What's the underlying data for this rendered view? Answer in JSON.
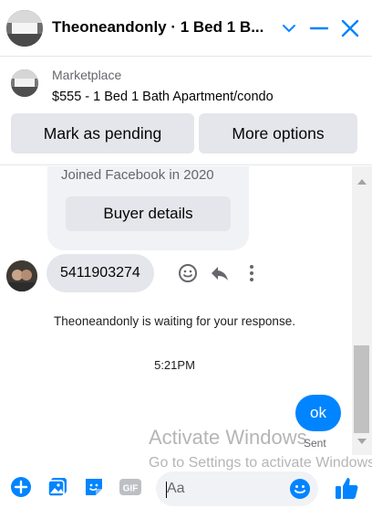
{
  "header": {
    "title": "Theoneandonly · 1 Bed 1 B...",
    "avatar_icon": "profile-photo",
    "icons": [
      "chevron-down-icon",
      "minimize-icon",
      "close-icon"
    ],
    "accent": "#0084ff"
  },
  "listing": {
    "label": "Marketplace",
    "title": "$555 - 1 Bed 1 Bath Apartment/condo",
    "buttons": {
      "pending": "Mark as pending",
      "more": "More options"
    }
  },
  "chat": {
    "joined": "Joined Facebook in 2020",
    "buyer_details": "Buyer details",
    "phone_message": "5411903274",
    "waiting": "Theoneandonly is waiting for your response.",
    "time": "5:21PM",
    "outgoing_message": "ok",
    "status": "Sent"
  },
  "watermark": {
    "line1": "Activate Windows",
    "line2": "Go to Settings to activate Windows."
  },
  "composer": {
    "placeholder": "Aa",
    "icons": [
      "add-icon",
      "photo-icon",
      "sticker-icon",
      "gif-icon",
      "emoji-icon",
      "thumbs-up-icon"
    ]
  }
}
